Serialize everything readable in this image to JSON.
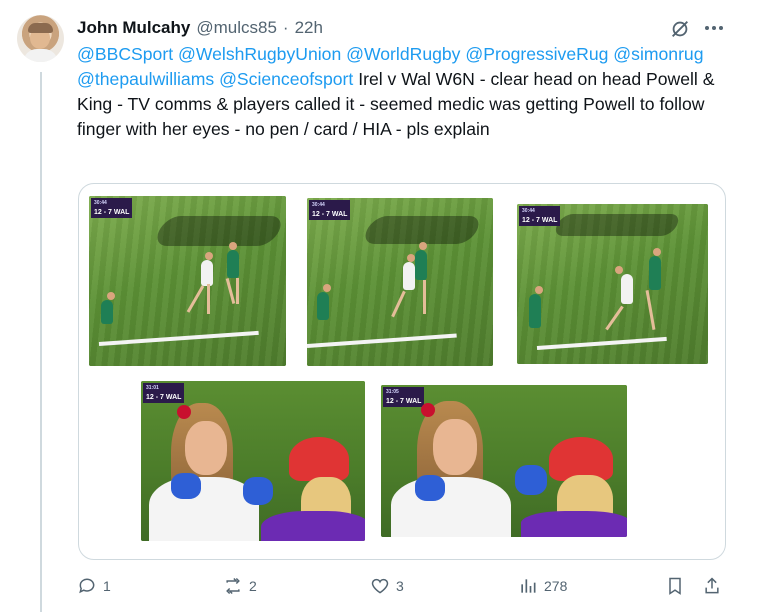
{
  "tweet": {
    "author_name": "John Mulcahy",
    "handle": "@mulcs85",
    "separator": "·",
    "time": "22h",
    "mentions": [
      "@BBCSport",
      "@WelshRugbyUnion",
      "@WorldRugby",
      "@ProgressiveRug",
      "@simonrug",
      "@thepaulwilliams",
      "@Scienceofsport"
    ],
    "text": "Irel v Wal W6N - clear head on head Powell & King - TV comms & players called it - seemed medic was getting Powell to follow finger with her eyes - no pen / card / HIA - pls explain"
  },
  "media": {
    "frames": [
      {
        "score": "12 - 7",
        "team": "WAL",
        "clock": "30:44"
      },
      {
        "score": "12 - 7",
        "team": "WAL",
        "clock": "30:44"
      },
      {
        "score": "12 - 7",
        "team": "WAL",
        "clock": "30:44"
      },
      {
        "score": "12 - 7",
        "team": "WAL",
        "clock": "31:01"
      },
      {
        "score": "12 - 7",
        "team": "WAL",
        "clock": "31:05"
      }
    ]
  },
  "actions": {
    "replies": "1",
    "reposts": "2",
    "likes": "3",
    "views": "278"
  },
  "icons": {
    "grok": "grok-icon",
    "more": "more-icon",
    "reply": "reply-icon",
    "repost": "repost-icon",
    "like": "like-icon",
    "views": "views-icon",
    "bookmark": "bookmark-icon",
    "share": "share-icon"
  },
  "colors": {
    "link": "#1d9bf0",
    "secondary": "#536471",
    "score_bg": "#2b1a4a"
  }
}
